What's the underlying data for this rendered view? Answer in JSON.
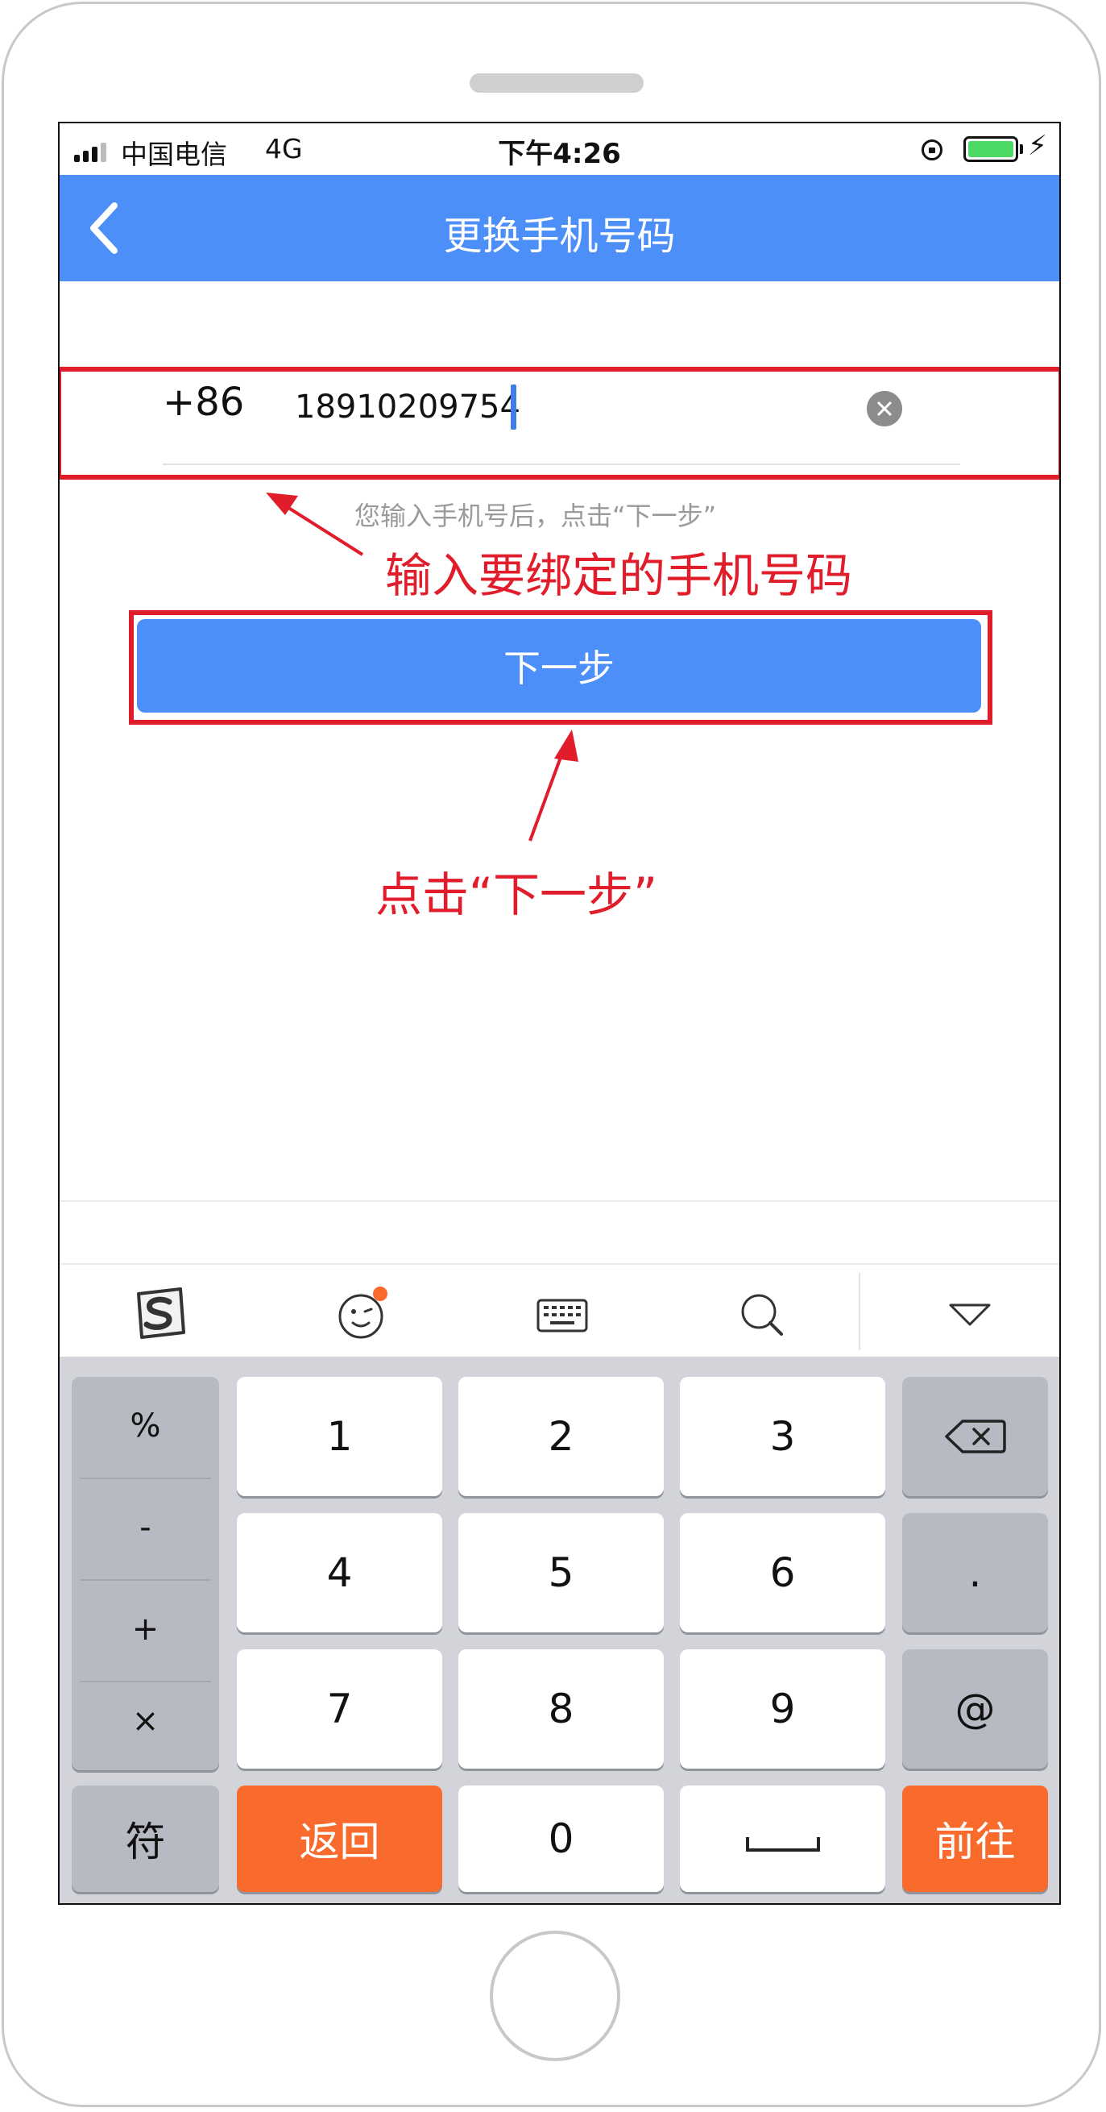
{
  "status_bar": {
    "carrier": "中国电信",
    "network": "4G",
    "time": "下午4:26"
  },
  "nav": {
    "title": "更换手机号码"
  },
  "phone_form": {
    "country_code": "+86",
    "phone_value": "18910209754",
    "hint": "您输入手机号后，点击“下一步”",
    "next_label": "下一步"
  },
  "annotations": {
    "input_note": "输入要绑定的手机号码",
    "button_note": "点击“下一步”",
    "color": "#e21d2b"
  },
  "keyboard": {
    "toolbar_icons": [
      "sogou-logo-icon",
      "emoji-icon",
      "keyboard-icon",
      "search-icon",
      "collapse-icon"
    ],
    "side_symbols": [
      "%",
      "-",
      "+",
      "×"
    ],
    "digits": [
      "1",
      "2",
      "3",
      "4",
      "5",
      "6",
      "7",
      "8",
      "9",
      "0"
    ],
    "dot": ".",
    "at": "@",
    "symbols_label": "符",
    "back_label": "返回",
    "go_label": "前往",
    "space_label": "␣",
    "accent_color": "#f96a2d"
  },
  "colors": {
    "primary": "#4d8ff8",
    "battery": "#4cd964"
  }
}
